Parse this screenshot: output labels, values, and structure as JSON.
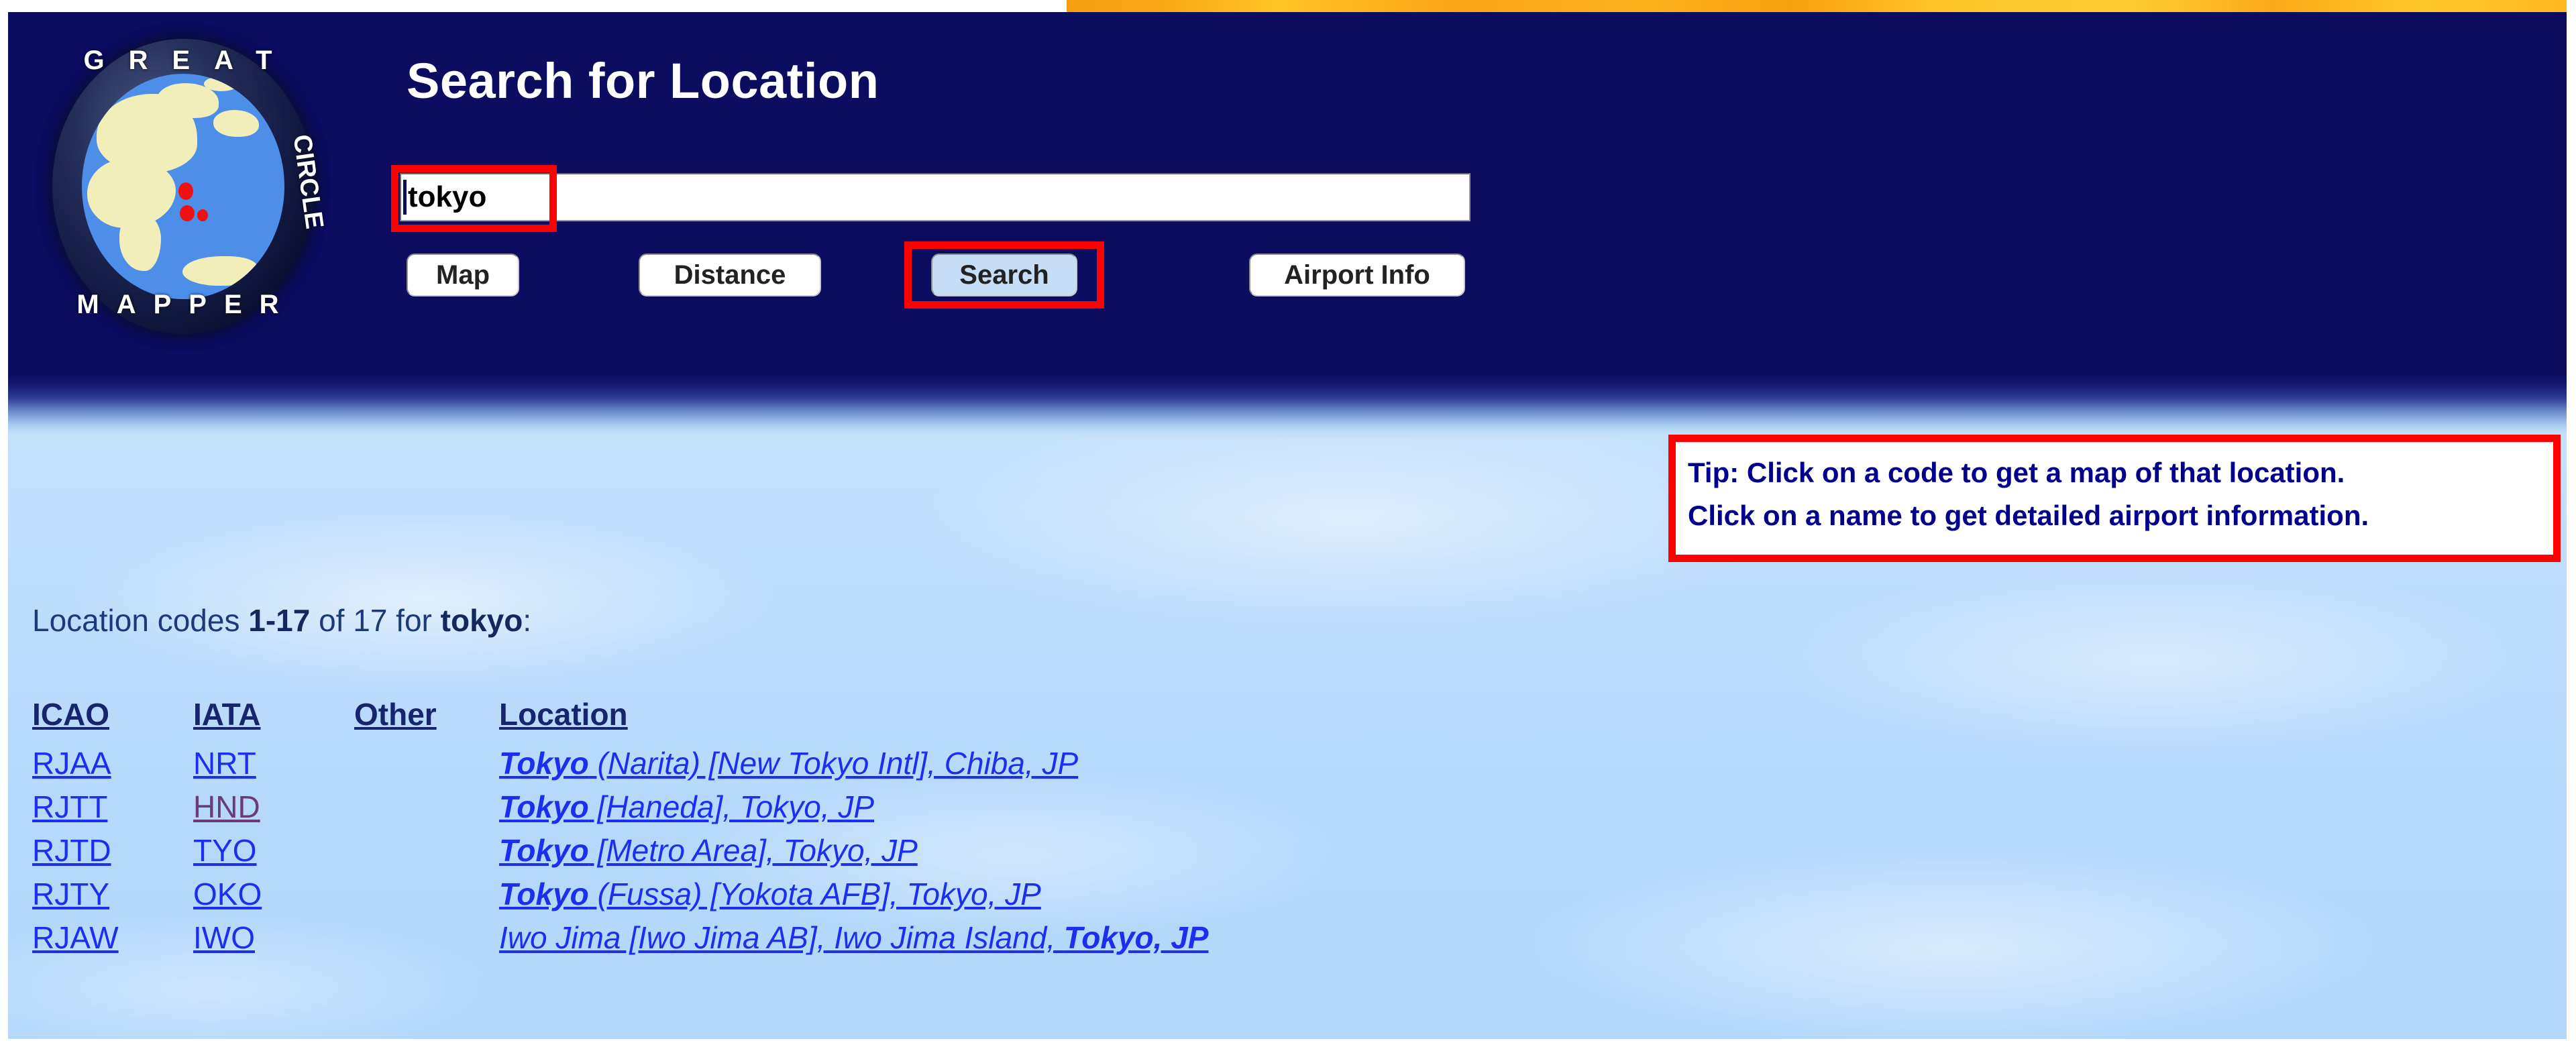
{
  "site": {
    "logo_words": {
      "top": "GREAT",
      "right": "CIRCLE",
      "bottom": "MAPPER",
      "left": ""
    },
    "logo_alt": "great-circle-mapper-globe-logo"
  },
  "header": {
    "title": "Search for Location"
  },
  "search": {
    "value": "tokyo",
    "placeholder": "",
    "buttons": [
      {
        "id": "map",
        "label": "Map"
      },
      {
        "id": "distance",
        "label": "Distance"
      },
      {
        "id": "search",
        "label": "Search"
      },
      {
        "id": "airport_info",
        "label": "Airport Info"
      }
    ]
  },
  "tip": {
    "line1": "Tip: Click on a code to get a map of that location.",
    "line2": "Click on a name to get detailed airport information."
  },
  "results": {
    "summary_prefix": "Location codes ",
    "summary_range": "1-17",
    "summary_mid": " of 17 for ",
    "summary_query": "tokyo",
    "summary_suffix": ":",
    "columns": [
      "ICAO",
      "IATA",
      "Other",
      "Location"
    ],
    "rows": [
      {
        "icao": "RJAA",
        "iata": "NRT",
        "other": "",
        "location_strong": "Tokyo",
        "location_rest": " (Narita) [New Tokyo Intl], Chiba, JP",
        "location_trailing_strong": "",
        "iata_visited": false
      },
      {
        "icao": "RJTT",
        "iata": "HND",
        "other": "",
        "location_strong": "Tokyo",
        "location_rest": " [Haneda], Tokyo, JP",
        "location_trailing_strong": "",
        "iata_visited": true
      },
      {
        "icao": "RJTD",
        "iata": "TYO",
        "other": "",
        "location_strong": "Tokyo",
        "location_rest": " [Metro Area], Tokyo, JP",
        "location_trailing_strong": "",
        "iata_visited": false
      },
      {
        "icao": "RJTY",
        "iata": "OKO",
        "other": "",
        "location_strong": "Tokyo",
        "location_rest": " (Fussa) [Yokota AFB], Tokyo, JP",
        "location_trailing_strong": "",
        "iata_visited": false
      },
      {
        "icao": "RJAW",
        "iata": "IWO",
        "other": "",
        "location_strong": "",
        "location_rest": "Iwo Jima [Iwo Jima AB], Iwo Jima Island, ",
        "location_trailing_strong": "Tokyo, JP",
        "iata_visited": false
      }
    ]
  },
  "colors": {
    "header_navy": "#0c0c60",
    "sky_blue": "#b8dcfb",
    "highlight_red": "#ff0000",
    "link_blue": "#1c2ff0",
    "accent_orange": "#ffb71e",
    "search_button_fill": "#c5ddf5"
  }
}
